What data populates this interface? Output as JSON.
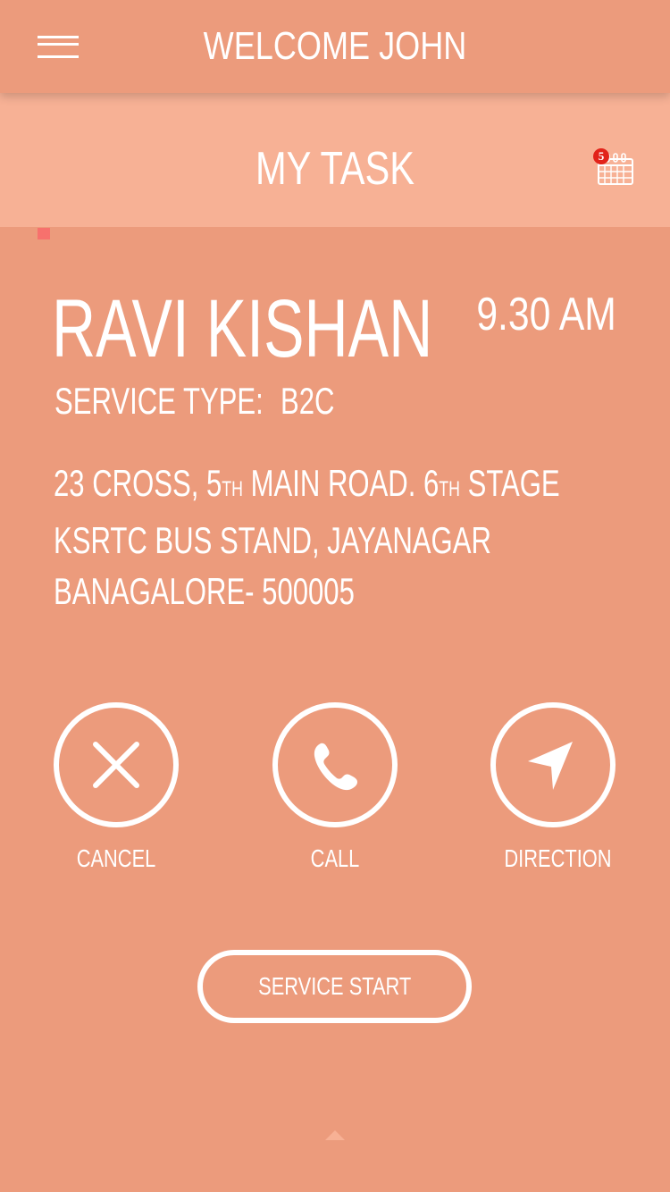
{
  "header": {
    "title": "WELCOME JOHN",
    "menu_icon": "hamburger-menu-icon"
  },
  "task_bar": {
    "title": "MY TASK",
    "calendar_icon": "calendar-icon",
    "badge_count": "5"
  },
  "task": {
    "customer_name": "RAVI KISHAN",
    "time": "9.30 AM",
    "service_type_label": "SERVICE TYPE:",
    "service_type_value": "B2C",
    "address": {
      "line1_a": "23 CROSS, 5",
      "line1_sup1": "TH",
      "line1_b": " MAIN ROAD. 6",
      "line1_sup2": "TH",
      "line1_c": " STAGE",
      "line2": "KSRTC BUS STAND, JAYANAGAR",
      "line3": "BANAGALORE- 500005"
    }
  },
  "actions": {
    "cancel": {
      "label": "CANCEL",
      "icon": "close-icon"
    },
    "call": {
      "label": "CALL",
      "icon": "phone-icon"
    },
    "direction": {
      "label": "DIRECTION",
      "icon": "navigation-arrow-icon"
    }
  },
  "primary_button": {
    "label": "SERVICE START"
  },
  "footer": {
    "icon": "chevron-up-icon"
  },
  "colors": {
    "background": "#ec9b7c",
    "task_bar": "#f7b195",
    "badge": "#e2231a",
    "marker": "#f7716d",
    "foreground": "#ffffff"
  }
}
